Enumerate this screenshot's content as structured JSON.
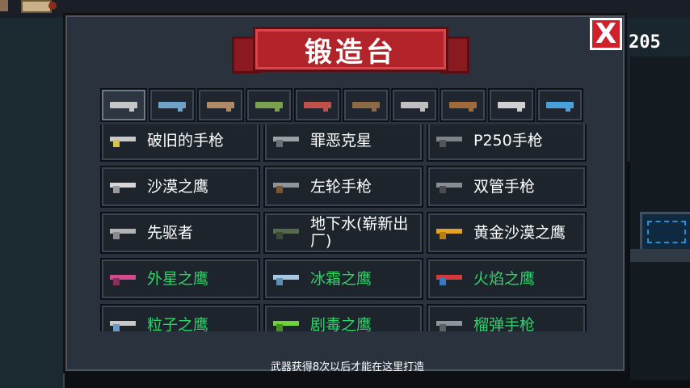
{
  "header": {
    "title": "锻造台",
    "close_label": "X",
    "coin_count": "205"
  },
  "tabs": [
    {
      "icon": "pistol-icon",
      "color": "#c7c7c7"
    },
    {
      "icon": "rifle-icon",
      "color": "#6fa2c8"
    },
    {
      "icon": "shotgun-icon",
      "color": "#b08a66"
    },
    {
      "icon": "launcher-icon",
      "color": "#7aa24d"
    },
    {
      "icon": "rocket-icon",
      "color": "#c0514a"
    },
    {
      "icon": "bow-icon",
      "color": "#8b6a45"
    },
    {
      "icon": "sword-icon",
      "color": "#bfbfbf"
    },
    {
      "icon": "staff-icon",
      "color": "#a06a3a"
    },
    {
      "icon": "crosshair-icon",
      "color": "#d0d0d0"
    },
    {
      "icon": "fish-icon",
      "color": "#4aa0d8"
    }
  ],
  "weapons": [
    {
      "name": "破旧的手枪",
      "color": "#ffffff",
      "gun": "#c9c9c9",
      "grip": "#d8c24a"
    },
    {
      "name": "罪恶克星",
      "color": "#ffffff",
      "gun": "#9aa0a6",
      "grip": "#6a6f75"
    },
    {
      "name": "P250手枪",
      "color": "#ffffff",
      "gun": "#7f8489",
      "grip": "#555"
    },
    {
      "name": "沙漠之鹰",
      "color": "#ffffff",
      "gun": "#d6d6d6",
      "grip": "#9a9a9a"
    },
    {
      "name": "左轮手枪",
      "color": "#ffffff",
      "gun": "#8f949a",
      "grip": "#7a5535"
    },
    {
      "name": "双管手枪",
      "color": "#ffffff",
      "gun": "#8a8e93",
      "grip": "#4a4d50"
    },
    {
      "name": "先驱者",
      "color": "#ffffff",
      "gun": "#b4b4b4",
      "grip": "#8a8a8a"
    },
    {
      "name": "地下水(崭新出厂)",
      "color": "#ffffff",
      "gun": "#556b4d",
      "grip": "#3c4a36"
    },
    {
      "name": "黄金沙漠之鹰",
      "color": "#ffffff",
      "gun": "#e3a324",
      "grip": "#b87d14"
    },
    {
      "name": "外星之鹰",
      "color": "#2fd36a",
      "gun": "#d14c8c",
      "grip": "#8a2f5c"
    },
    {
      "name": "冰霜之鹰",
      "color": "#2fd36a",
      "gun": "#a7c8e0",
      "grip": "#5f8fb2"
    },
    {
      "name": "火焰之鹰",
      "color": "#2fd36a",
      "gun": "#d23a3a",
      "grip": "#3a7ac0"
    },
    {
      "name": "粒子之鹰",
      "color": "#2fd36a",
      "gun": "#c9c9c9",
      "grip": "#6b9ac7"
    },
    {
      "name": "剧毒之鹰",
      "color": "#2fd36a",
      "gun": "#6fd23a",
      "grip": "#4a8c24"
    },
    {
      "name": "榴弹手枪",
      "color": "#2fd36a",
      "gun": "#8f949a",
      "grip": "#5c6166"
    }
  ],
  "footer": {
    "note": "武器获得8次以后才能在这里打造"
  }
}
